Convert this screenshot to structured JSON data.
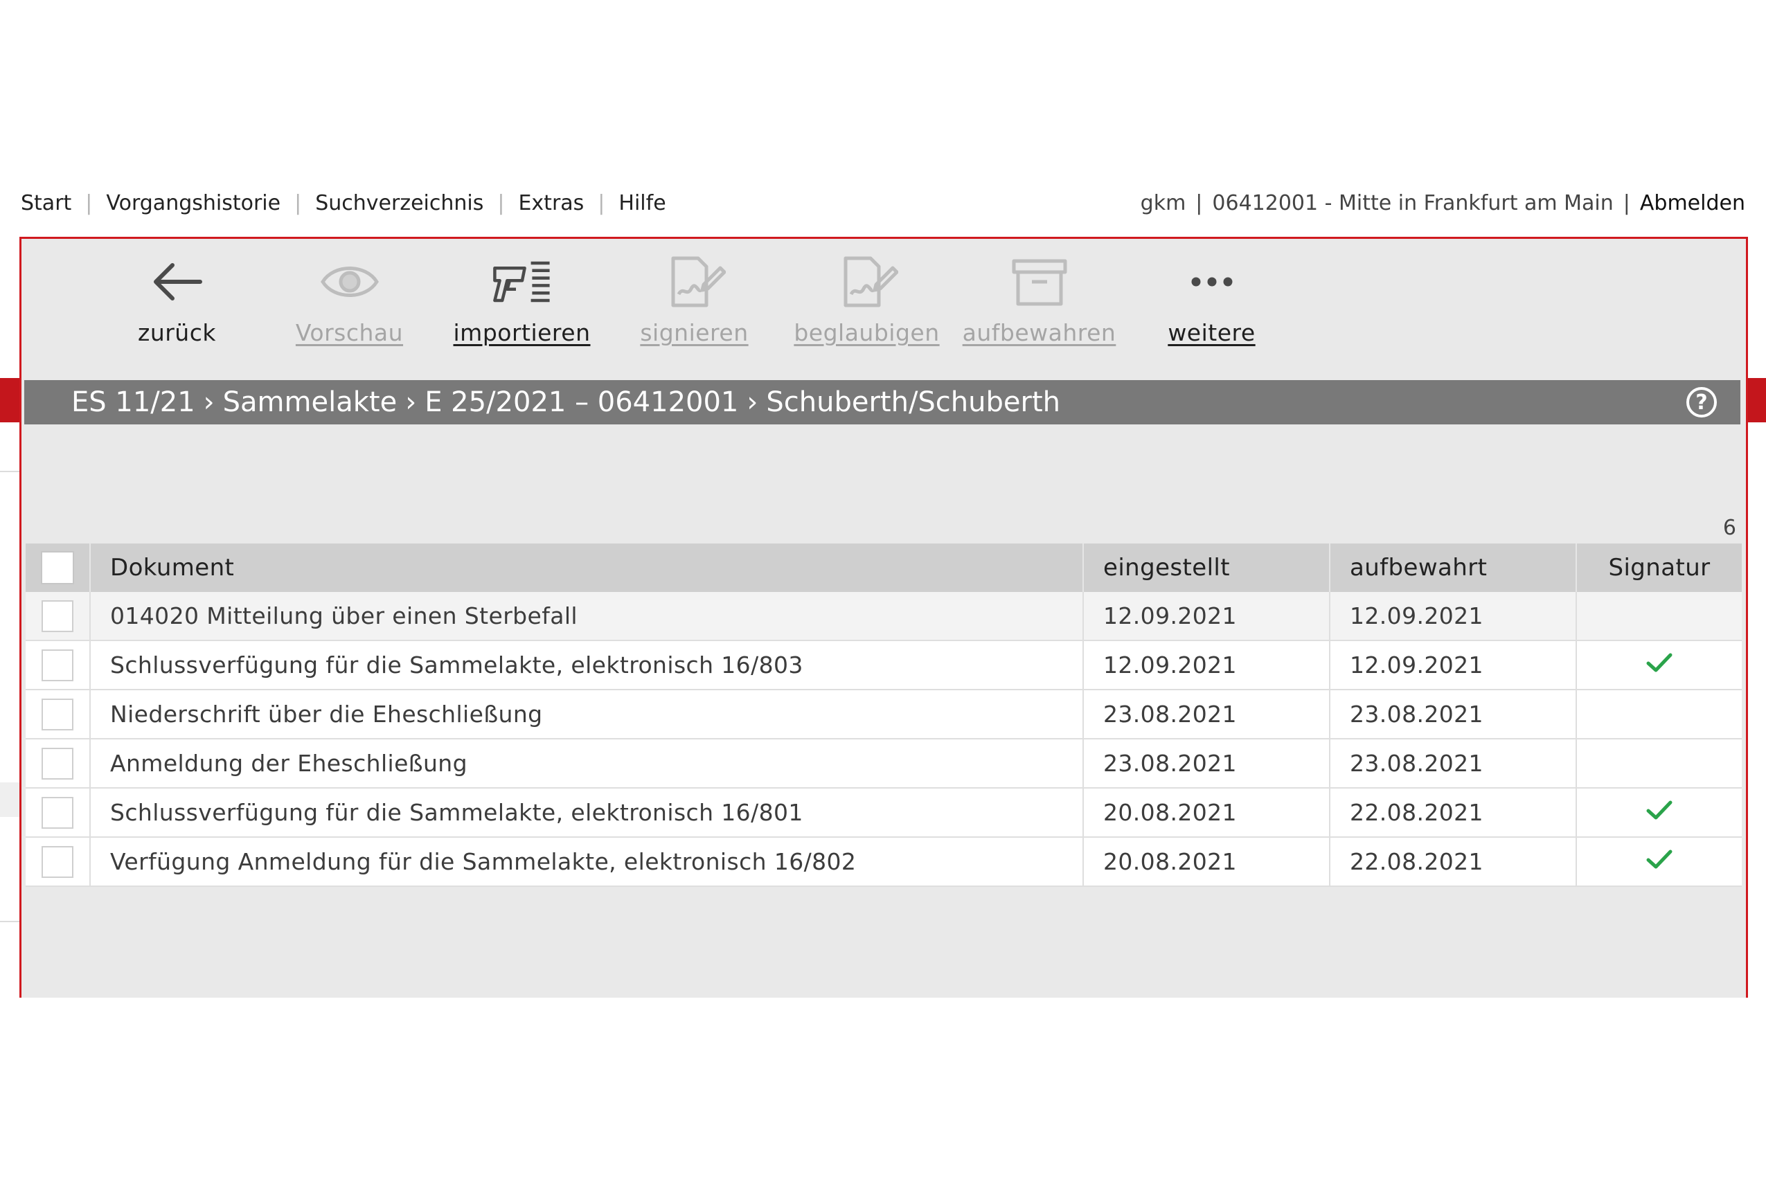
{
  "nav": {
    "items": [
      "Start",
      "Vorgangshistorie",
      "Suchverzeichnis",
      "Extras",
      "Hilfe"
    ],
    "user": "gkm",
    "office": "06412001 - Mitte in Frankfurt am Main",
    "logout": "Abmelden"
  },
  "toolbar": {
    "back": "zurück",
    "preview": "Vorschau",
    "import": "importieren",
    "sign": "signieren",
    "certify": "beglaubigen",
    "archive": "aufbewahren",
    "more": "weitere"
  },
  "breadcrumb": {
    "items": [
      "ES 11/21",
      "Sammelakte",
      "E 25/2021 – 06412001",
      "Schuberth/Schuberth"
    ],
    "separator": "›",
    "help": "?"
  },
  "table": {
    "count": "6",
    "columns": [
      "Dokument",
      "eingestellt",
      "aufbewahrt",
      "Signatur"
    ],
    "rows": [
      {
        "doc": "014020 Mitteilung über einen Sterbefall",
        "eingestellt": "12.09.2021",
        "aufbewahrt": "12.09.2021",
        "signed": false
      },
      {
        "doc": "Schlussverfügung für die Sammelakte, elektronisch 16/803",
        "eingestellt": "12.09.2021",
        "aufbewahrt": "12.09.2021",
        "signed": true
      },
      {
        "doc": "Niederschrift über die Eheschließung",
        "eingestellt": "23.08.2021",
        "aufbewahrt": "23.08.2021",
        "signed": false
      },
      {
        "doc": "Anmeldung der Eheschließung",
        "eingestellt": "23.08.2021",
        "aufbewahrt": "23.08.2021",
        "signed": false
      },
      {
        "doc": "Schlussverfügung für die Sammelakte, elektronisch 16/801",
        "eingestellt": "20.08.2021",
        "aufbewahrt": "22.08.2021",
        "signed": true
      },
      {
        "doc": "Verfügung Anmeldung für die Sammelakte, elektronisch 16/802",
        "eingestellt": "20.08.2021",
        "aufbewahrt": "22.08.2021",
        "signed": true
      }
    ]
  },
  "colors": {
    "accent": "#d0191f",
    "breadcrumb_bg": "#797979",
    "panel_bg": "#e9e9e9",
    "check": "#2aa34a"
  }
}
